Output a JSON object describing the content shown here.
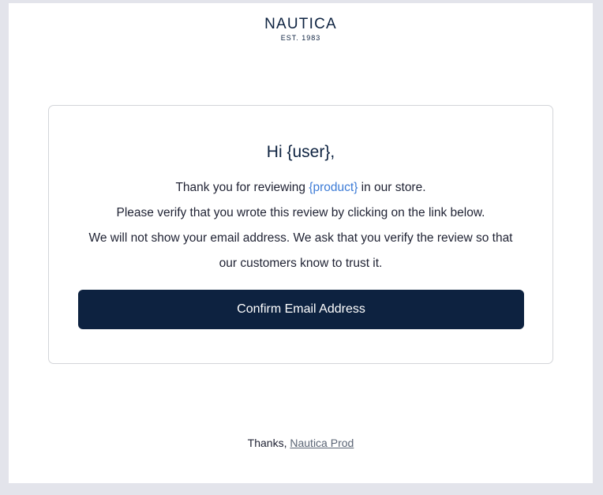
{
  "header": {
    "brand_name": "NAUTICA",
    "brand_tagline": "EST. 1983"
  },
  "card": {
    "greeting": "Hi {user},",
    "line1_prefix": "Thank you for reviewing ",
    "line1_link": "{product}",
    "line1_suffix": " in our store.",
    "line2": "Please verify that you wrote this review by clicking on the link below.",
    "line3": "We will not show your email address. We ask that you verify the review so that",
    "line4": "our customers know to trust it.",
    "button_label": "Confirm Email Address"
  },
  "footer": {
    "thanks_text": "Thanks, ",
    "sender_link": "Nautica Prod"
  },
  "colors": {
    "page_background": "#e3e4eb",
    "brand_navy": "#0d2240",
    "link_blue": "#3c7bd6"
  }
}
